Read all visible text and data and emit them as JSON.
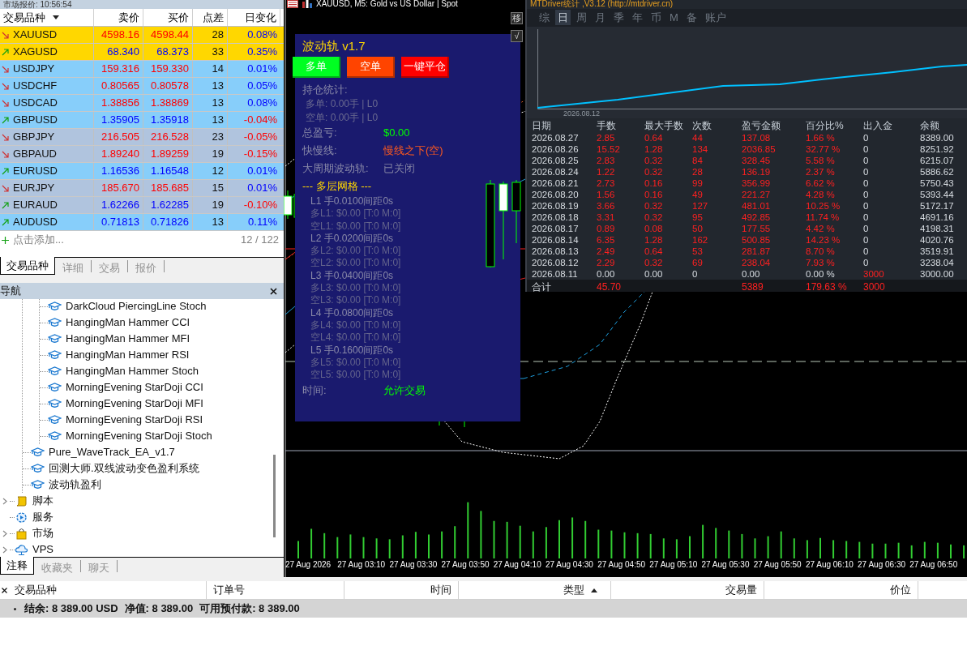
{
  "market_watch": {
    "title": "市场报价: 10:56:54",
    "columns": [
      "交易品种",
      "卖价",
      "买价",
      "点差",
      "日变化"
    ],
    "rows": [
      {
        "symbol": "XAUUSD",
        "down": true,
        "color": "#ffd700",
        "bid": {
          "text": "4598.16",
          "down": true
        },
        "ask": {
          "text": "4598.44",
          "down": true
        },
        "spread": "28",
        "change": {
          "text": "0.08%",
          "down": false
        }
      },
      {
        "symbol": "XAGUSD",
        "down": false,
        "color": "#ffd700",
        "bid": {
          "text": "68.340",
          "down": false
        },
        "ask": {
          "text": "68.373",
          "down": false
        },
        "spread": "33",
        "change": {
          "text": "0.35%",
          "down": false
        }
      },
      {
        "symbol": "USDJPY",
        "down": true,
        "color": "#87cefa",
        "bid": {
          "text": "159.316",
          "down": true
        },
        "ask": {
          "text": "159.330",
          "down": true
        },
        "spread": "14",
        "change": {
          "text": "0.01%",
          "down": false
        }
      },
      {
        "symbol": "USDCHF",
        "down": true,
        "color": "#87cefa",
        "bid": {
          "text": "0.80565",
          "down": true
        },
        "ask": {
          "text": "0.80578",
          "down": true
        },
        "spread": "13",
        "change": {
          "text": "0.05%",
          "down": false
        }
      },
      {
        "symbol": "USDCAD",
        "down": true,
        "color": "#87cefa",
        "bid": {
          "text": "1.38856",
          "down": true
        },
        "ask": {
          "text": "1.38869",
          "down": true
        },
        "spread": "13",
        "change": {
          "text": "0.08%",
          "down": false
        }
      },
      {
        "symbol": "GBPUSD",
        "down": false,
        "color": "#87cefa",
        "bid": {
          "text": "1.35905",
          "down": false
        },
        "ask": {
          "text": "1.35918",
          "down": false
        },
        "spread": "13",
        "change": {
          "text": "-0.04%",
          "down": true
        }
      },
      {
        "symbol": "GBPJPY",
        "down": true,
        "color": "#b0c4de",
        "bid": {
          "text": "216.505",
          "down": true
        },
        "ask": {
          "text": "216.528",
          "down": true
        },
        "spread": "23",
        "change": {
          "text": "-0.05%",
          "down": true
        }
      },
      {
        "symbol": "GBPAUD",
        "down": true,
        "color": "#b0c4de",
        "bid": {
          "text": "1.89240",
          "down": true
        },
        "ask": {
          "text": "1.89259",
          "down": true
        },
        "spread": "19",
        "change": {
          "text": "-0.15%",
          "down": true
        }
      },
      {
        "symbol": "EURUSD",
        "down": false,
        "color": "#87cefa",
        "bid": {
          "text": "1.16536",
          "down": false
        },
        "ask": {
          "text": "1.16548",
          "down": false
        },
        "spread": "12",
        "change": {
          "text": "0.01%",
          "down": false
        }
      },
      {
        "symbol": "EURJPY",
        "down": true,
        "color": "#b0c4de",
        "bid": {
          "text": "185.670",
          "down": true
        },
        "ask": {
          "text": "185.685",
          "down": true
        },
        "spread": "15",
        "change": {
          "text": "0.01%",
          "down": false
        }
      },
      {
        "symbol": "EURAUD",
        "down": false,
        "color": "#b0c4de",
        "bid": {
          "text": "1.62266",
          "down": false
        },
        "ask": {
          "text": "1.62285",
          "down": false
        },
        "spread": "19",
        "change": {
          "text": "-0.10%",
          "down": true
        }
      },
      {
        "symbol": "AUDUSD",
        "down": false,
        "color": "#87cefa",
        "bid": {
          "text": "0.71813",
          "down": false
        },
        "ask": {
          "text": "0.71826",
          "down": false
        },
        "spread": "13",
        "change": {
          "text": "0.11%",
          "down": false
        }
      }
    ],
    "add_label": "点击添加...",
    "count": "12 / 122",
    "tabs": [
      {
        "label": "交易品种",
        "selected": true
      },
      {
        "label": "详细",
        "selected": false
      },
      {
        "label": "交易",
        "selected": false
      },
      {
        "label": "报价",
        "selected": false
      }
    ]
  },
  "navigator": {
    "title": "导航",
    "tree": [
      {
        "children": [
          {
            "children": [
              {
                "kind": "expert",
                "label": "DarkCloud PiercingLine Stoch"
              },
              {
                "kind": "expert",
                "label": "HangingMan Hammer CCI"
              },
              {
                "kind": "expert",
                "label": "HangingMan Hammer MFI"
              },
              {
                "kind": "expert",
                "label": "HangingMan Hammer RSI"
              },
              {
                "kind": "expert",
                "label": "HangingMan Hammer Stoch"
              },
              {
                "kind": "expert",
                "label": "MorningEvening StarDoji CCI"
              },
              {
                "kind": "expert",
                "label": "MorningEvening StarDoji MFI"
              },
              {
                "kind": "expert",
                "label": "MorningEvening StarDoji RSI"
              },
              {
                "kind": "expert",
                "label": "MorningEvening StarDoji Stoch"
              }
            ]
          },
          {
            "kind": "expert",
            "label": "Pure_WaveTrack_EA_v1.7"
          },
          {
            "kind": "expert",
            "label": "回测大师.双线波动变色盈利系统"
          },
          {
            "kind": "expert",
            "label": "波动轨盈利"
          }
        ]
      },
      {
        "kind": "scripts",
        "label": "脚本",
        "expanded": false
      },
      {
        "kind": "services",
        "label": "服务"
      },
      {
        "kind": "market",
        "label": "市场",
        "expanded": false
      },
      {
        "kind": "vps",
        "label": "VPS",
        "expanded": false
      }
    ],
    "tabs": [
      {
        "label": "注释",
        "selected": true
      },
      {
        "label": "收藏夹",
        "selected": false
      },
      {
        "label": "聊天",
        "selected": false
      }
    ]
  },
  "chart": {
    "title": "XAUUSD, M5:  Gold vs US Dollar | Spot",
    "time_labels": [
      "27 Aug 2026",
      "27 Aug 03:10",
      "27 Aug 03:30",
      "27 Aug 03:50",
      "27 Aug 04:10",
      "27 Aug 04:30",
      "27 Aug 04:50",
      "27 Aug 05:10",
      "27 Aug 05:30",
      "27 Aug 05:50",
      "27 Aug 06:10",
      "27 Aug 06:30",
      "27 Aug 06:50"
    ],
    "side_buttons": [
      "移",
      "√"
    ]
  },
  "wave_panel": {
    "title": "波动轨 v1.7",
    "buttons": [
      {
        "label": "多单",
        "color": "#00ff22"
      },
      {
        "label": "空单",
        "color": "#ff4400"
      },
      {
        "label": "一键平仓",
        "color": "#ff0000"
      }
    ],
    "lines": [
      {
        "kind": "heading",
        "text": "持仓统计:"
      },
      {
        "kind": "detail",
        "text": "多单: 0.00手 | L0"
      },
      {
        "kind": "detail",
        "text": "空单: 0.00手 | L0"
      },
      {
        "kind": "pair",
        "label": "总盈亏:",
        "value": "$0.00",
        "color": "#00ff00"
      },
      {
        "kind": "pair",
        "label": "快慢线:",
        "value": "慢线之下(空)",
        "color": "#ff5a1e"
      },
      {
        "kind": "pair",
        "label": "大周期波动轨:",
        "value": "已关闭",
        "color": "#8484a4"
      },
      {
        "kind": "section",
        "text": "--- 多层网格 ---"
      },
      {
        "kind": "level",
        "text": "L1 手0.0100间距0s"
      },
      {
        "kind": "grid",
        "text": "多L1: $0.00 [T:0 M:0]"
      },
      {
        "kind": "grid",
        "text": "空L1: $0.00 [T:0 M:0]"
      },
      {
        "kind": "level",
        "text": "L2 手0.0200间距0s"
      },
      {
        "kind": "grid",
        "text": "多L2: $0.00 [T:0 M:0]"
      },
      {
        "kind": "grid",
        "text": "空L2: $0.00 [T:0 M:0]"
      },
      {
        "kind": "level",
        "text": "L3 手0.0400间距0s"
      },
      {
        "kind": "grid",
        "text": "多L3: $0.00 [T:0 M:0]"
      },
      {
        "kind": "grid",
        "text": "空L3: $0.00 [T:0 M:0]"
      },
      {
        "kind": "level",
        "text": "L4 手0.0800间距0s"
      },
      {
        "kind": "grid",
        "text": "多L4: $0.00 [T:0 M:0]"
      },
      {
        "kind": "grid",
        "text": "空L4: $0.00 [T:0 M:0]"
      },
      {
        "kind": "level",
        "text": "L5 手0.1600间距0s"
      },
      {
        "kind": "grid",
        "text": "多L5: $0.00 [T:0 M:0]"
      },
      {
        "kind": "grid",
        "text": "空L5: $0.00 [T:0 M:0]"
      },
      {
        "kind": "pair",
        "label": "时间:",
        "value": "允许交易",
        "color": "#00ff00"
      }
    ]
  },
  "stats": {
    "title": "MTDriver统计 ,V3.12 (http://mtdriver.cn)",
    "tabs": [
      {
        "label": "综",
        "selected": false
      },
      {
        "label": "日",
        "selected": true
      },
      {
        "label": "周",
        "selected": false
      },
      {
        "label": "月",
        "selected": false
      },
      {
        "label": "季",
        "selected": false
      },
      {
        "label": "年",
        "selected": false
      },
      {
        "label": "币",
        "selected": false
      },
      {
        "label": "M",
        "selected": false
      },
      {
        "label": "备",
        "selected": false
      },
      {
        "label": "账户",
        "selected": false
      }
    ],
    "curve_label": "2026.08.12",
    "columns": [
      "日期",
      "手数",
      "最大手数",
      "次数",
      "盈亏金额",
      "百分比%",
      "出入金",
      "余额"
    ],
    "rows": [
      {
        "kind": "trading",
        "cells": [
          "2026.08.27",
          "2.85",
          "0.64",
          "44",
          "137.08",
          "1.66 %",
          "0",
          "8389.00"
        ]
      },
      {
        "kind": "trading",
        "cells": [
          "2026.08.26",
          "15.52",
          "1.28",
          "134",
          "2036.85",
          "32.77 %",
          "0",
          "8251.92"
        ]
      },
      {
        "kind": "trading",
        "cells": [
          "2026.08.25",
          "2.83",
          "0.32",
          "84",
          "328.45",
          "5.58 %",
          "0",
          "6215.07"
        ]
      },
      {
        "kind": "trading",
        "cells": [
          "2026.08.24",
          "1.22",
          "0.32",
          "28",
          "136.19",
          "2.37 %",
          "0",
          "5886.62"
        ]
      },
      {
        "kind": "trading",
        "cells": [
          "2026.08.21",
          "2.73",
          "0.16",
          "99",
          "356.99",
          "6.62 %",
          "0",
          "5750.43"
        ]
      },
      {
        "kind": "trading",
        "cells": [
          "2026.08.20",
          "1.56",
          "0.16",
          "49",
          "221.27",
          "4.28 %",
          "0",
          "5393.44"
        ]
      },
      {
        "kind": "trading",
        "cells": [
          "2026.08.19",
          "3.66",
          "0.32",
          "127",
          "481.01",
          "10.25 %",
          "0",
          "5172.17"
        ]
      },
      {
        "kind": "trading",
        "cells": [
          "2026.08.18",
          "3.31",
          "0.32",
          "95",
          "492.85",
          "11.74 %",
          "0",
          "4691.16"
        ]
      },
      {
        "kind": "trading",
        "cells": [
          "2026.08.17",
          "0.89",
          "0.08",
          "50",
          "177.55",
          "4.42 %",
          "0",
          "4198.31"
        ]
      },
      {
        "kind": "trading",
        "cells": [
          "2026.08.14",
          "6.35",
          "1.28",
          "162",
          "500.85",
          "14.23 %",
          "0",
          "4020.76"
        ]
      },
      {
        "kind": "trading",
        "cells": [
          "2026.08.13",
          "2.49",
          "0.64",
          "53",
          "281.87",
          "8.70 %",
          "0",
          "3519.91"
        ]
      },
      {
        "kind": "trading",
        "cells": [
          "2026.08.12",
          "2.29",
          "0.32",
          "69",
          "238.04",
          "7.93 %",
          "0",
          "3238.04"
        ]
      },
      {
        "kind": "deposit",
        "cells": [
          "2026.08.11",
          "0.00",
          "0.00",
          "0",
          "0.00",
          "0.00 %",
          "3000",
          "3000.00"
        ]
      }
    ],
    "total": {
      "label": "合计",
      "lots": "45.70",
      "profit": "5389",
      "percent": "179.63 %",
      "deposit": "3000"
    }
  },
  "terminal": {
    "columns": [
      {
        "label": "交易品种"
      },
      {
        "label": "订单号"
      },
      {
        "label": "时间"
      },
      {
        "label": "类型",
        "sorted": true
      },
      {
        "label": "交易量"
      },
      {
        "label": "价位"
      }
    ],
    "summary": [
      "结余: 8 389.00 USD",
      "净值: 8 389.00",
      "可用预付款: 8 389.00"
    ]
  }
}
